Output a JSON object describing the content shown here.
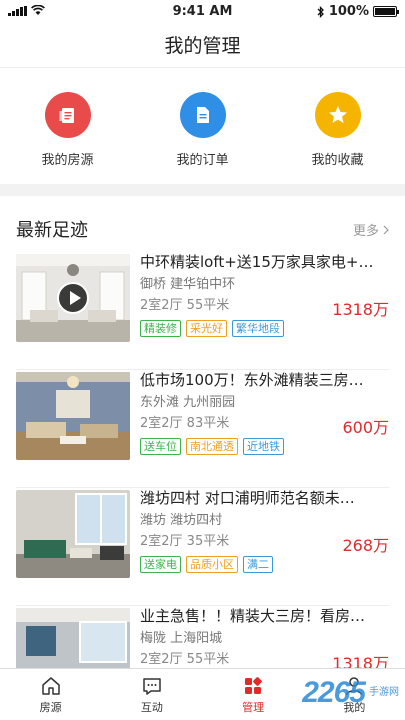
{
  "status": {
    "time": "9:41 AM",
    "battery": "100%"
  },
  "page_title": "我的管理",
  "quick_actions": [
    {
      "label": "我的房源",
      "icon": "house-doc-icon",
      "color": "#e94b4b"
    },
    {
      "label": "我的订单",
      "icon": "order-doc-icon",
      "color": "#2f8fe6"
    },
    {
      "label": "我的收藏",
      "icon": "star-icon",
      "color": "#f5b400"
    }
  ],
  "section": {
    "title": "最新足迹",
    "more": "更多"
  },
  "listings": [
    {
      "title": "中环精装loft+送15万家具家电+…",
      "location": "御桥  建华铂中环",
      "layout": "2室2厅 55平米",
      "price": "1318万",
      "tags": [
        {
          "text": "精装修",
          "color": "green"
        },
        {
          "text": "采光好",
          "color": "orange"
        },
        {
          "text": "繁华地段",
          "color": "blue"
        }
      ]
    },
    {
      "title": "低市场100万！东外滩精装三房…",
      "location": "东外滩  九州丽园",
      "layout": "2室2厅 83平米",
      "price": "600万",
      "tags": [
        {
          "text": "送车位",
          "color": "green"
        },
        {
          "text": "南北通透",
          "color": "orange"
        },
        {
          "text": "近地铁",
          "color": "blue"
        }
      ]
    },
    {
      "title": "潍坊四村 对口浦明师范名额未…",
      "location": "潍坊  潍坊四村",
      "layout": "2室2厅 35平米",
      "price": "268万",
      "tags": [
        {
          "text": "送家电",
          "color": "green"
        },
        {
          "text": "品质小区",
          "color": "orange"
        },
        {
          "text": "满二",
          "color": "blue"
        }
      ]
    },
    {
      "title": "业主急售！！精装大三房！看房…",
      "location": "梅陇  上海阳城",
      "layout": "2室2厅 55平米",
      "price": "1318万",
      "tags": []
    }
  ],
  "tabs": [
    {
      "label": "房源",
      "icon": "home-icon"
    },
    {
      "label": "互动",
      "icon": "chat-icon"
    },
    {
      "label": "管理",
      "icon": "grid-icon"
    },
    {
      "label": "我的",
      "icon": "user-icon"
    }
  ],
  "watermark": {
    "logo": "2265",
    "text": "手游网"
  }
}
